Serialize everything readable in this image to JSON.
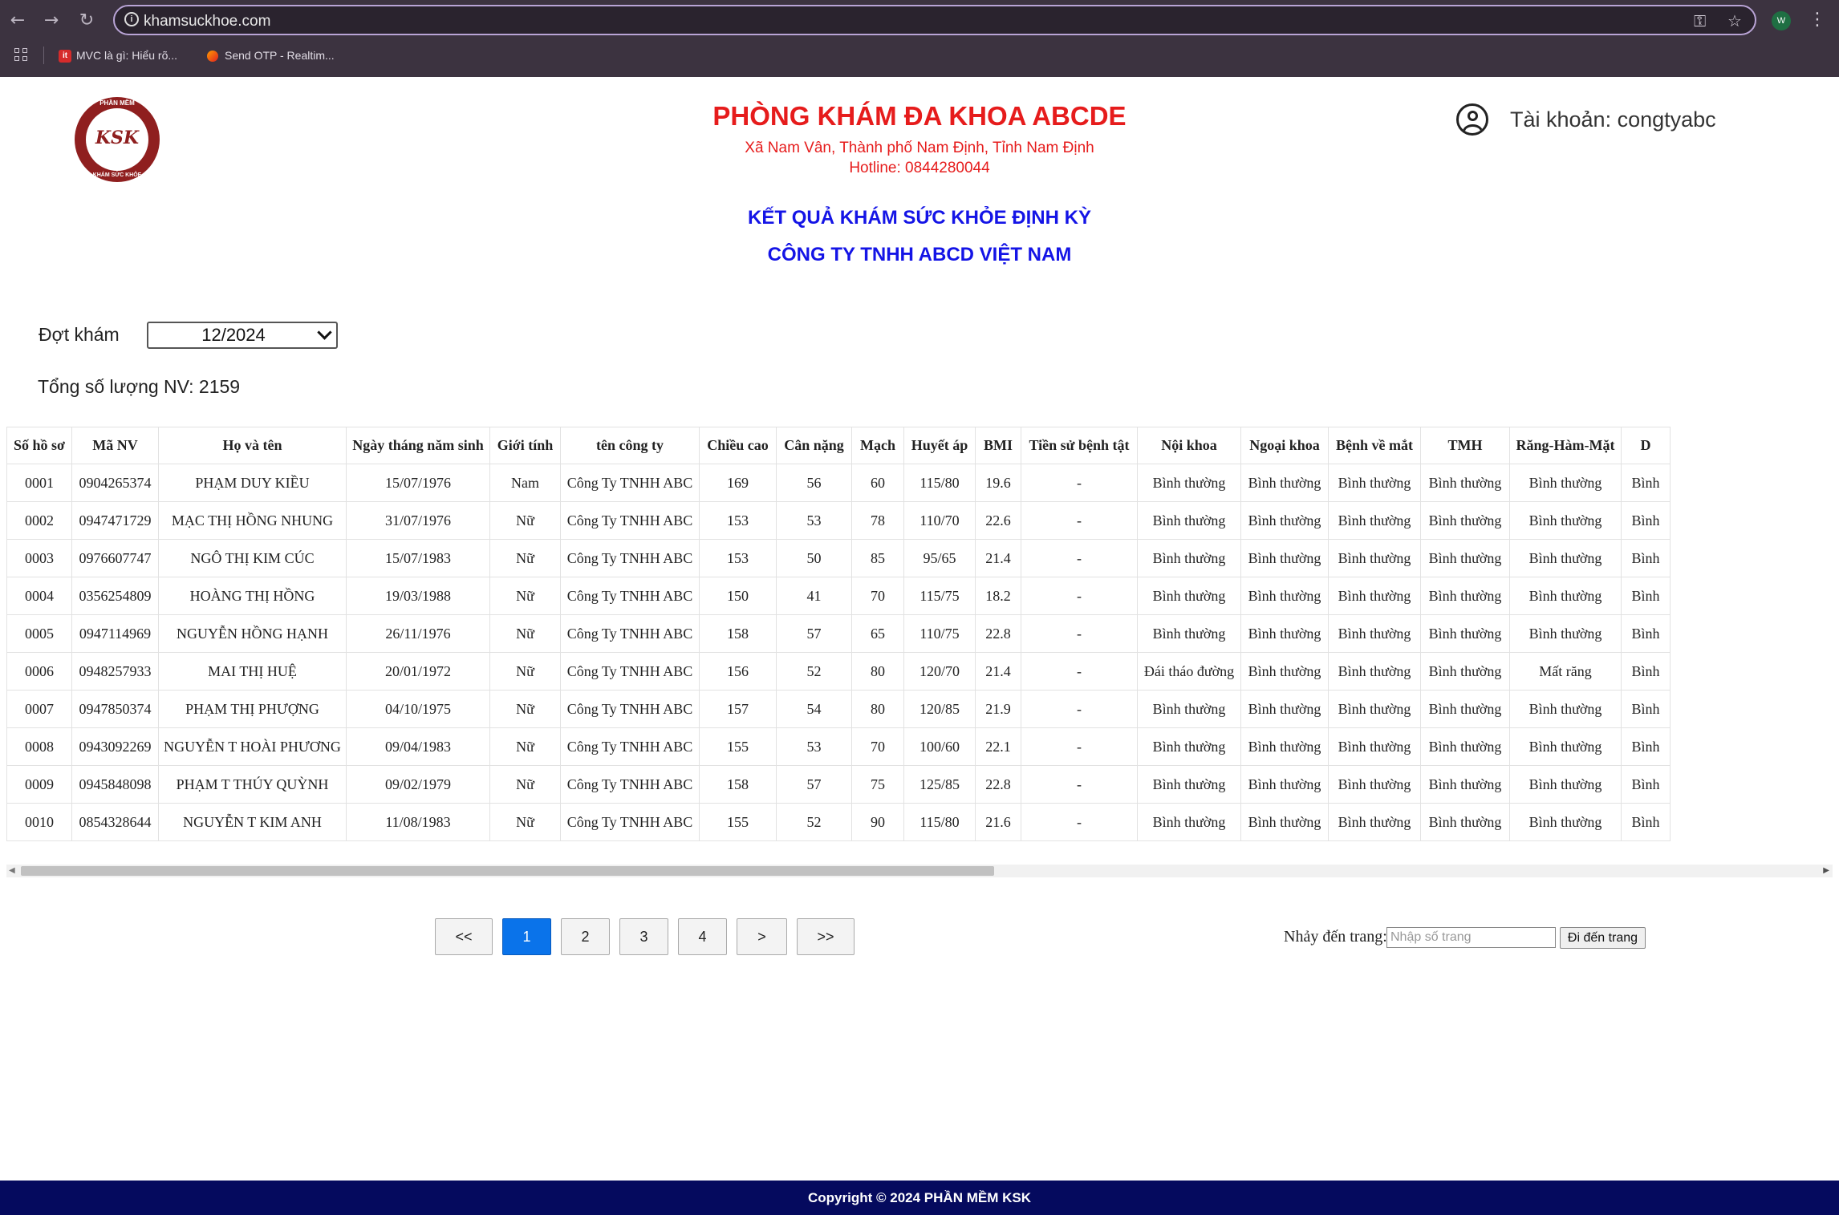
{
  "browser": {
    "url": "khamsuckhoe.com",
    "profile_initial": "W",
    "bookmarks": [
      {
        "label": "MVC là gì: Hiểu rõ...",
        "favicon": "it"
      },
      {
        "label": "Send OTP - Realtim..."
      }
    ]
  },
  "header": {
    "logo_text": "KSK",
    "logo_ring_top": "PHẦN MỀM",
    "logo_ring_bottom": "KHÁM SỨC KHỎE",
    "clinic_name": "PHÒNG KHÁM ĐA KHOA ABCDE",
    "address": "Xã Nam Vân, Thành phố Nam Định, Tỉnh Nam Định",
    "hotline": "Hotline: 0844280044",
    "result_title": "KẾT QUẢ KHÁM SỨC KHỎE ĐỊNH KỲ",
    "company_title": "CÔNG TY TNHH ABCD VIỆT NAM",
    "account_label": "Tài khoản: congtyabc"
  },
  "filters": {
    "period_label": "Đợt khám",
    "period_value": "12/2024",
    "total_label": "Tổng số lượng NV: 2159"
  },
  "table": {
    "columns": [
      "Số hồ sơ",
      "Mã NV",
      "Họ và tên",
      "Ngày tháng năm sinh",
      "Giới tính",
      "tên công ty",
      "Chiều cao",
      "Cân nặng",
      "Mạch",
      "Huyết áp",
      "BMI",
      "Tiền sử bệnh tật",
      "Nội khoa",
      "Ngoại khoa",
      "Bệnh về mắt",
      "TMH",
      "Răng-Hàm-Mặt",
      "D"
    ],
    "rows": [
      [
        "0001",
        "0904265374",
        "PHẠM DUY KIỀU",
        "15/07/1976",
        "Nam",
        "Công Ty TNHH ABC",
        "169",
        "56",
        "60",
        "115/80",
        "19.6",
        "-",
        "Bình thường",
        "Bình thường",
        "Bình thường",
        "Bình thường",
        "Bình thường",
        "Bình"
      ],
      [
        "0002",
        "0947471729",
        "MẠC THỊ HỒNG NHUNG",
        "31/07/1976",
        "Nữ",
        "Công Ty TNHH ABC",
        "153",
        "53",
        "78",
        "110/70",
        "22.6",
        "-",
        "Bình thường",
        "Bình thường",
        "Bình thường",
        "Bình thường",
        "Bình thường",
        "Bình"
      ],
      [
        "0003",
        "0976607747",
        "NGÔ THỊ KIM CÚC",
        "15/07/1983",
        "Nữ",
        "Công Ty TNHH ABC",
        "153",
        "50",
        "85",
        "95/65",
        "21.4",
        "-",
        "Bình thường",
        "Bình thường",
        "Bình thường",
        "Bình thường",
        "Bình thường",
        "Bình"
      ],
      [
        "0004",
        "0356254809",
        "HOÀNG THỊ HỒNG",
        "19/03/1988",
        "Nữ",
        "Công Ty TNHH ABC",
        "150",
        "41",
        "70",
        "115/75",
        "18.2",
        "-",
        "Bình thường",
        "Bình thường",
        "Bình thường",
        "Bình thường",
        "Bình thường",
        "Bình"
      ],
      [
        "0005",
        "0947114969",
        "NGUYỄN HỒNG HẠNH",
        "26/11/1976",
        "Nữ",
        "Công Ty TNHH ABC",
        "158",
        "57",
        "65",
        "110/75",
        "22.8",
        "-",
        "Bình thường",
        "Bình thường",
        "Bình thường",
        "Bình thường",
        "Bình thường",
        "Bình"
      ],
      [
        "0006",
        "0948257933",
        "MAI THỊ HUỆ",
        "20/01/1972",
        "Nữ",
        "Công Ty TNHH ABC",
        "156",
        "52",
        "80",
        "120/70",
        "21.4",
        "-",
        "Đái tháo đường",
        "Bình thường",
        "Bình thường",
        "Bình thường",
        "Mất răng",
        "Bình"
      ],
      [
        "0007",
        "0947850374",
        "PHẠM THỊ PHƯỢNG",
        "04/10/1975",
        "Nữ",
        "Công Ty TNHH ABC",
        "157",
        "54",
        "80",
        "120/85",
        "21.9",
        "-",
        "Bình thường",
        "Bình thường",
        "Bình thường",
        "Bình thường",
        "Bình thường",
        "Bình"
      ],
      [
        "0008",
        "0943092269",
        "NGUYỄN T HOÀI PHƯƠNG",
        "09/04/1983",
        "Nữ",
        "Công Ty TNHH ABC",
        "155",
        "53",
        "70",
        "100/60",
        "22.1",
        "-",
        "Bình thường",
        "Bình thường",
        "Bình thường",
        "Bình thường",
        "Bình thường",
        "Bình"
      ],
      [
        "0009",
        "0945848098",
        "PHẠM T THÚY QUỲNH",
        "09/02/1979",
        "Nữ",
        "Công Ty TNHH ABC",
        "158",
        "57",
        "75",
        "125/85",
        "22.8",
        "-",
        "Bình thường",
        "Bình thường",
        "Bình thường",
        "Bình thường",
        "Bình thường",
        "Bình"
      ],
      [
        "0010",
        "0854328644",
        "NGUYỄN T KIM ANH",
        "11/08/1983",
        "Nữ",
        "Công Ty TNHH ABC",
        "155",
        "52",
        "90",
        "115/80",
        "21.6",
        "-",
        "Bình thường",
        "Bình thường",
        "Bình thường",
        "Bình thường",
        "Bình thường",
        "Bình"
      ]
    ]
  },
  "pagination": {
    "first": "<<",
    "pages": [
      "1",
      "2",
      "3",
      "4"
    ],
    "current": "1",
    "next": ">",
    "last": ">>",
    "jump_label": "Nhảy đến trang:",
    "jump_placeholder": "Nhập số trang",
    "jump_button": "Đi đến trang"
  },
  "footer": {
    "copyright": "Copyright © 2024 PHẦN MỀM KSK"
  },
  "colors": {
    "clinic_red": "#e61c1c",
    "title_blue": "#1414e6",
    "active_page": "#0a73ea",
    "footer_bg": "#050a5e",
    "logo": "#8f1f1f"
  },
  "icons": [
    "back-arrow-icon",
    "forward-arrow-icon",
    "reload-icon",
    "site-info-icon",
    "password-key-icon",
    "bookmark-star-icon",
    "more-menu-icon",
    "apps-grid-icon",
    "user-circle-icon",
    "chevron-down-icon"
  ]
}
